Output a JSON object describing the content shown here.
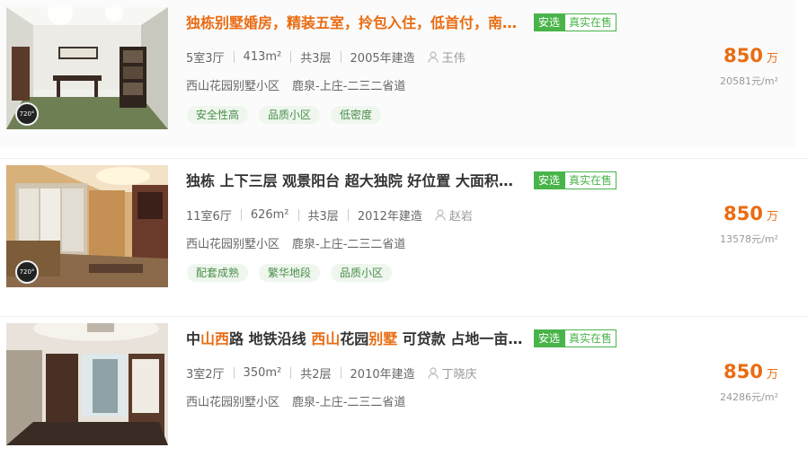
{
  "listings": [
    {
      "title": "独栋别墅婚房，精装五室，拎包入住，低首付，南…",
      "badge_an": "安选",
      "badge_real": "真实在售",
      "layout": "5室3厅",
      "area": "413m²",
      "floors": "共3层",
      "year": "2005年建造",
      "agent": "王伟",
      "community": "西山花园别墅小区",
      "district": "鹿泉-上庄-二三二省道",
      "features": [
        "安全性高",
        "品质小区",
        "低密度"
      ],
      "price": "850",
      "price_unit": "万",
      "unit_price": "20581元/m²",
      "vr_label": "720°"
    },
    {
      "title": "独栋 上下三层 观景阳台 超大独院 好位置 大面积…",
      "badge_an": "安选",
      "badge_real": "真实在售",
      "layout": "11室6厅",
      "area": "626m²",
      "floors": "共3层",
      "year": "2012年建造",
      "agent": "赵岩",
      "community": "西山花园别墅小区",
      "district": "鹿泉-上庄-二三二省道",
      "features": [
        "配套成熟",
        "繁华地段",
        "品质小区"
      ],
      "price": "850",
      "price_unit": "万",
      "unit_price": "13578元/m²",
      "vr_label": "720°"
    },
    {
      "title_parts": [
        "中",
        "山西",
        "路 地铁沿线 ",
        "西山",
        "花园",
        "别墅",
        " 可贷款 占地一亩…"
      ],
      "badge_an": "安选",
      "badge_real": "真实在售",
      "layout": "3室2厅",
      "area": "350m²",
      "floors": "共2层",
      "year": "2010年建造",
      "agent": "丁晓庆",
      "community": "西山花园别墅小区",
      "district": "鹿泉-上庄-二三二省道",
      "price": "850",
      "price_unit": "万",
      "unit_price": "24286元/m²"
    }
  ],
  "icons": {
    "agent": "person-icon",
    "vr": "vr-720-icon"
  },
  "colors": {
    "accent": "#e96c12",
    "green": "#49b449"
  }
}
